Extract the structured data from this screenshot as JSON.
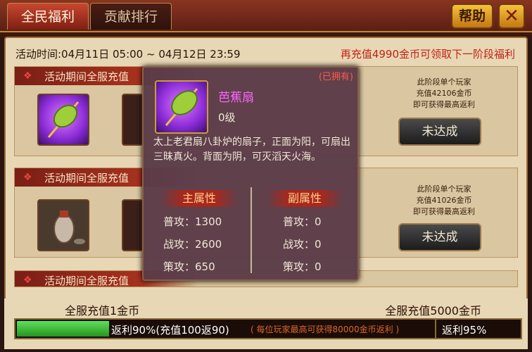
{
  "tabs": [
    {
      "label": "全民福利"
    },
    {
      "label": "贡献排行"
    }
  ],
  "header": {
    "help_label": "帮助",
    "close_glyph": "✕"
  },
  "activity": {
    "time": "活动时间:04月11日 05:00 ~ 04月12日 23:59",
    "next_stage": "再充值4990金币可领取下一阶段福利"
  },
  "rows": [
    {
      "title": "活动期间全服充值",
      "note_line1": "此阶段单个玩家",
      "note_line2": "充值42106金币",
      "note_line3": "即可获得最高返利",
      "status_label": "未达成"
    },
    {
      "title": "活动期间全服充值",
      "note_line1": "此阶段单个玩家",
      "note_line2": "充值41026金币",
      "note_line3": "即可获得最高返利",
      "status_label": "未达成"
    },
    {
      "title": "活动期间全服充值"
    }
  ],
  "progress": {
    "left_goal": "全服充值1金币",
    "right_goal": "全服充值5000金币",
    "fill_fraction": 0.183,
    "left_text": "返利90%(充值100返90)",
    "mid_text": "( 每位玩家最高可获得80000金币返利 )",
    "right_text": "返利95%"
  },
  "popup": {
    "owned": "(已拥有)",
    "name": "芭蕉扇",
    "level": "0级",
    "description": "太上老君扇八卦炉的扇子，正面为阳，可扇出三昧真火。背面为阴，可灭滔天火海。",
    "main_attr_title": "主属性",
    "sub_attr_title": "副属性",
    "main_attrs": [
      "普攻：1300",
      "战攻：2600",
      "策攻：650"
    ],
    "sub_attrs": [
      "普攻：0",
      "战攻：0",
      "策攻：0"
    ]
  },
  "icons": {
    "fan": "palm-leaf-fan-icon",
    "vase": "wine-vase-icon",
    "scroll": "red-scroll-icon",
    "knot": "chinese-knot-icon"
  }
}
